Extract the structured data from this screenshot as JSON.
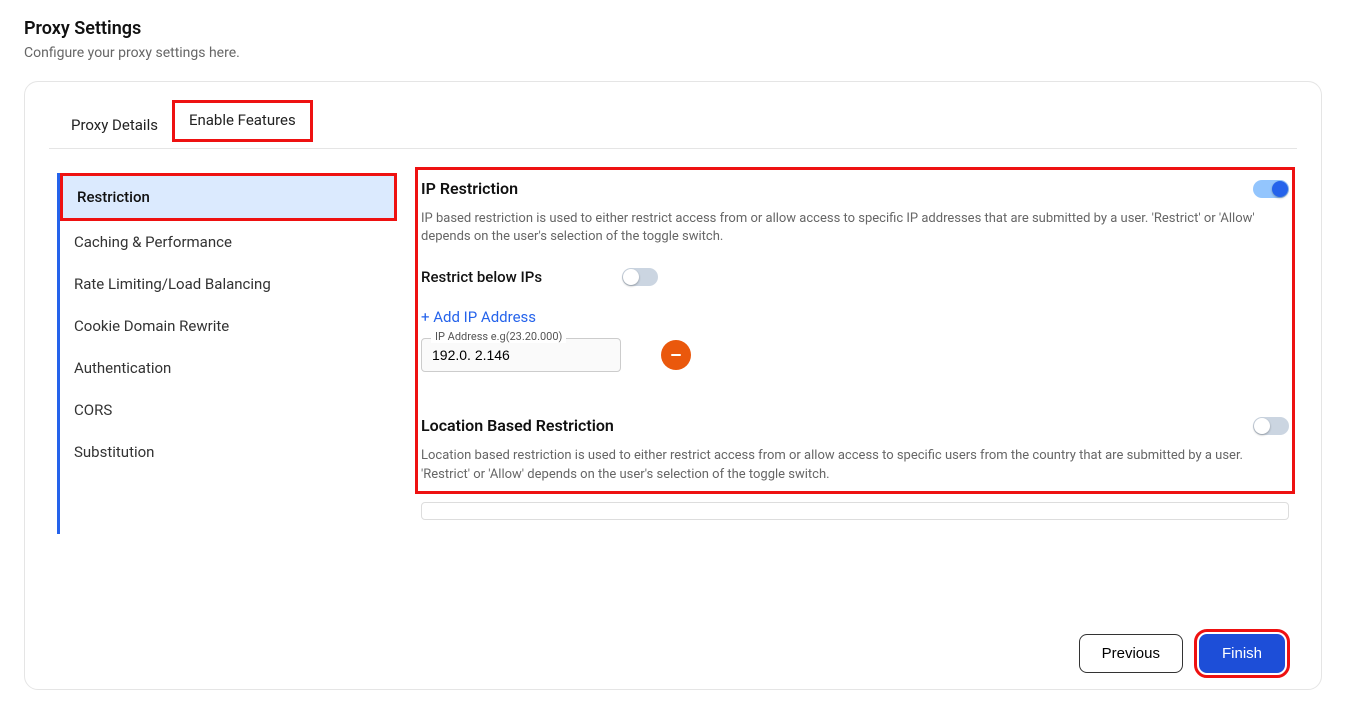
{
  "page": {
    "title": "Proxy Settings",
    "subtitle": "Configure your proxy settings here."
  },
  "tabs": [
    {
      "label": "Proxy Details",
      "active": false
    },
    {
      "label": "Enable Features",
      "active": true
    }
  ],
  "sidebar": {
    "items": [
      {
        "label": "Restriction",
        "active": true
      },
      {
        "label": "Caching & Performance",
        "active": false
      },
      {
        "label": "Rate Limiting/Load Balancing",
        "active": false
      },
      {
        "label": "Cookie Domain Rewrite",
        "active": false
      },
      {
        "label": "Authentication",
        "active": false
      },
      {
        "label": "CORS",
        "active": false
      },
      {
        "label": "Substitution",
        "active": false
      }
    ]
  },
  "ipRestriction": {
    "title": "IP Restriction",
    "enabled": true,
    "desc": "IP based restriction is used to either restrict access from or allow access to specific IP addresses that are submitted by a user. 'Restrict' or 'Allow' depends on the user's selection of the toggle switch.",
    "restrictLabel": "Restrict below IPs",
    "restrictEnabled": false,
    "addLabel": "+ Add IP Address",
    "ipFieldLegend": "IP Address e.g(23.20.000)",
    "ipValue": "192.0. 2.146"
  },
  "locationRestriction": {
    "title": "Location Based Restriction",
    "enabled": false,
    "desc": "Location based restriction is used to either restrict access from or allow access to specific users from the country that are submitted by a user. 'Restrict' or 'Allow' depends on the user's selection of the toggle switch."
  },
  "footer": {
    "previous": "Previous",
    "finish": "Finish"
  }
}
